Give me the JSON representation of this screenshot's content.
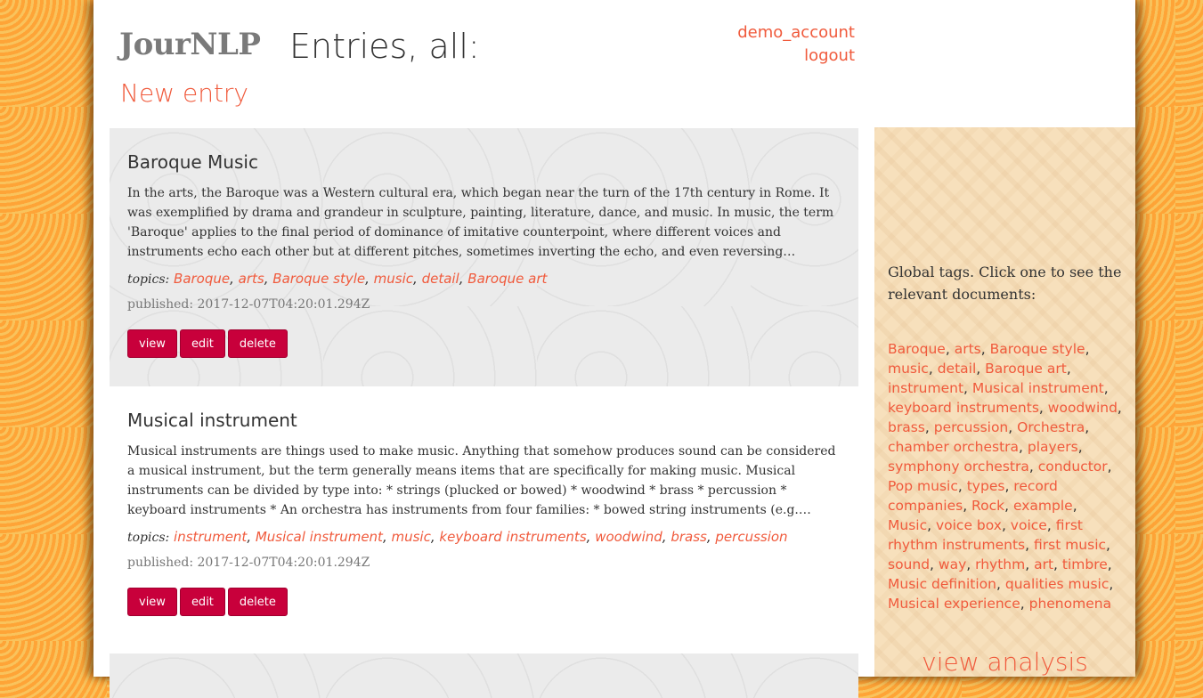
{
  "header": {
    "logo": "JourNLP",
    "title": "Entries, all:",
    "new_entry_label": "New entry",
    "username": "demo_account",
    "logout_label": "logout"
  },
  "entries": [
    {
      "title": "Baroque Music",
      "body": "In the arts, the Baroque was a Western cultural era, which began near the turn of the 17th century in Rome. It was exemplified by drama and grandeur in sculpture, painting, literature, dance, and music. In music, the term 'Baroque' applies to the final period of dominance of imitative counterpoint, where different voices and instruments echo each other but at different pitches, sometimes inverting the echo, and even reversing thematic...",
      "topics_label": "topics:",
      "topics": [
        "Baroque",
        "arts",
        "Baroque style",
        "music",
        "detail",
        "Baroque art"
      ],
      "published": "published: 2017-12-07T04:20:01.294Z",
      "buttons": {
        "view": "view",
        "edit": "edit",
        "delete": "delete"
      }
    },
    {
      "title": "Musical instrument",
      "body": "Musical instruments are things used to make music. Anything that somehow produces sound can be considered a musical instrument, but the term generally means items that are specifically for making music. Musical instruments can be divided by type into: * strings (plucked or bowed) * woodwind * brass * percussion * keyboard instruments * An orchestra has instruments from four families: * bowed string instruments (e.g. violin) * woodwin...",
      "topics_label": "topics:",
      "topics": [
        "instrument",
        "Musical instrument",
        "music",
        "keyboard instruments",
        "woodwind",
        "brass",
        "percussion"
      ],
      "published": "published: 2017-12-07T04:20:01.294Z",
      "buttons": {
        "view": "view",
        "edit": "edit",
        "delete": "delete"
      }
    }
  ],
  "sidebar": {
    "intro": "Global tags. Click one to see the relevant documents:",
    "tags": [
      "Baroque",
      "arts",
      "Baroque style",
      "music",
      "detail",
      "Baroque art",
      "instrument",
      "Musical instrument",
      "keyboard instruments",
      "woodwind",
      "brass",
      "percussion",
      "Orchestra",
      "chamber orchestra",
      "players",
      "symphony orchestra",
      "conductor",
      "Pop music",
      "types",
      "record companies",
      "Rock",
      "example",
      "Music",
      "voice box",
      "voice",
      "first rhythm instruments",
      "first music",
      "sound",
      "way",
      "rhythm",
      "art",
      "timbre",
      "Music definition",
      "qualities music",
      "Musical experience",
      "phenomena"
    ],
    "view_analysis_label": "view analysis"
  },
  "colors": {
    "accent": "#f05a3c",
    "button": "#c8003b",
    "background": "#fea437",
    "sidebar": "#f7e0bc"
  }
}
